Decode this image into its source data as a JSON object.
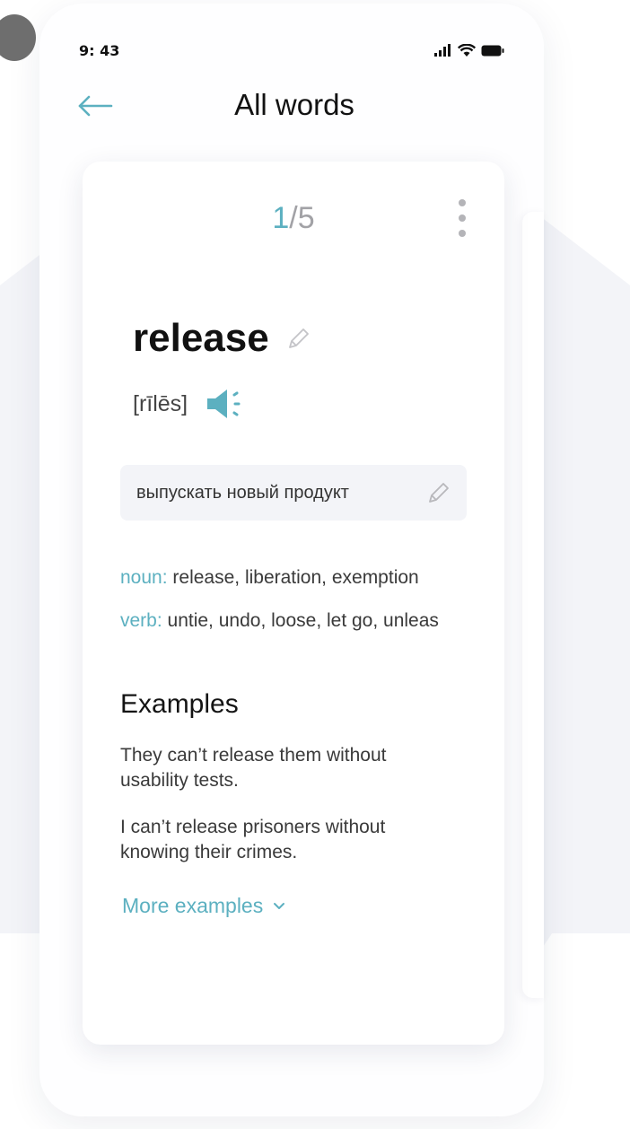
{
  "status_bar": {
    "time": "9: 43",
    "icons": [
      "signal-icon",
      "wifi-icon",
      "battery-icon"
    ]
  },
  "header": {
    "back_icon": "arrow-left-icon",
    "title": "All words"
  },
  "card": {
    "counter": {
      "current": "1",
      "total": "/5"
    },
    "menu_icon": "more-vertical-icon",
    "word": "release",
    "transcription": "[rīlēs]",
    "sound_icon": "speaker-icon",
    "translation": "выпускать новый продукт",
    "parts_of_speech": [
      {
        "label": "noun:",
        "text": " release, liberation, exemption"
      },
      {
        "label": "verb:",
        "text": " untie, undo, loose, let go, unleas"
      }
    ],
    "examples_title": "Examples",
    "examples": [
      "They can’t release them without usability tests.",
      "I can’t release prisoners without knowing their crimes."
    ],
    "more_examples": "More examples"
  },
  "colors": {
    "accent": "#5cb0c0",
    "background_shape": "#f3f4f8",
    "text": "#111111",
    "muted": "#a2a2a6"
  }
}
